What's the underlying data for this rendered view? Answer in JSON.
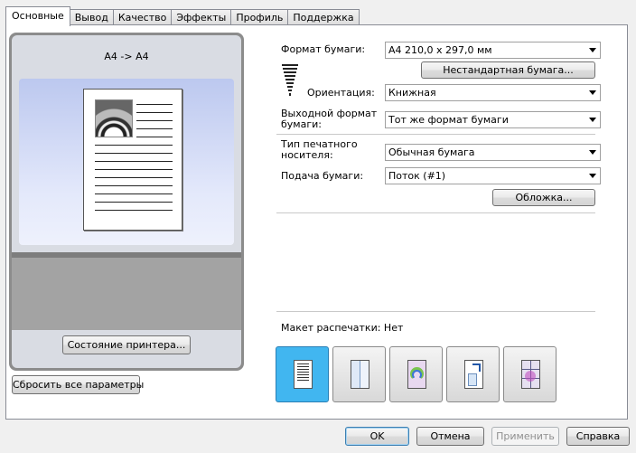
{
  "tabs": [
    "Основные",
    "Вывод",
    "Качество",
    "Эффекты",
    "Профиль",
    "Поддержка"
  ],
  "preview": {
    "label": "A4 -> A4"
  },
  "buttons": {
    "printer_status": "Состояние принтера...",
    "reset_all": "Сбросить все параметры",
    "custom_paper": "Нестандартная бумага...",
    "cover": "Обложка...",
    "ok": "OK",
    "cancel": "Отмена",
    "apply": "Применить",
    "help": "Справка"
  },
  "form": {
    "paper_size_label": "Формат бумаги:",
    "paper_size_value": "A4   210,0 x 297,0 мм",
    "orientation_label": "Ориентация:",
    "orientation_value": "Книжная",
    "output_size_label_1": "Выходной формат",
    "output_size_label_2": "бумаги:",
    "output_size_value": "Тот же формат бумаги",
    "media_type_label_1": "Тип печатного",
    "media_type_label_2": "носителя:",
    "media_type_value": "Обычная бумага",
    "paper_source_label": "Подача бумаги:",
    "paper_source_value": "Поток (#1)",
    "page_layout_label": "Макет распечатки: Нет"
  },
  "colors": {
    "selected_layout": "#41b6f0",
    "preview_blue": "#bcc8ef"
  },
  "icons": [
    "orientation-arrow-icon",
    "layout-1up-icon",
    "layout-booklet-icon",
    "layout-poster-icon",
    "layout-scale-icon",
    "layout-tile-icon"
  ]
}
